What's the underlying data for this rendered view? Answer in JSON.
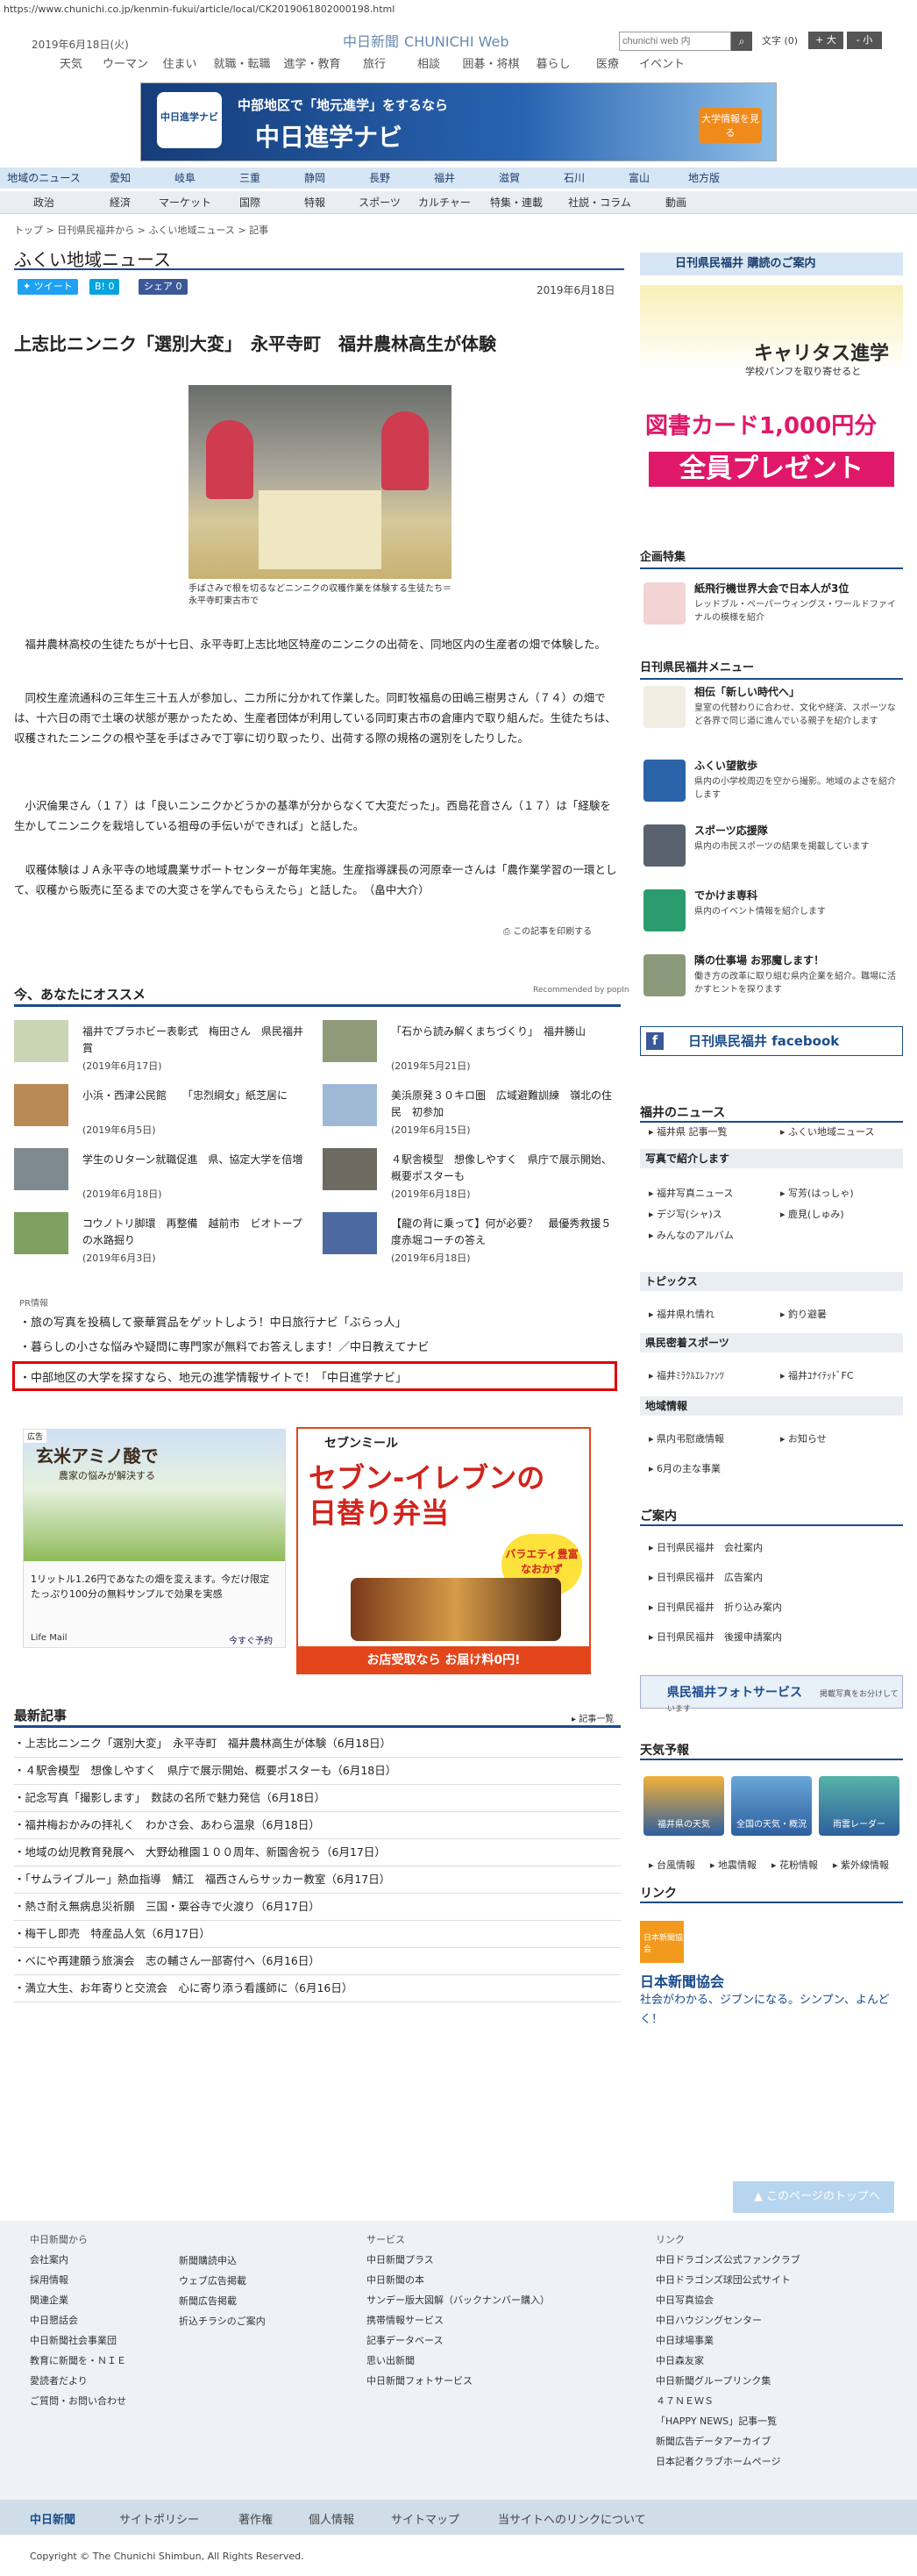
{
  "browser": {
    "url": "https://www.chunichi.co.jp/kenmin-fukui/article/local/CK2019061802000198.html"
  },
  "header": {
    "date": "2019年6月18日(火)",
    "logo": "中日新聞",
    "logo_sub": "CHUNICHI Web",
    "search_placeholder": "chunichi web 内",
    "search_btn": "検索",
    "font_label": "文字",
    "font_reset": "(0)",
    "font_large": "+ 大",
    "font_small": "- 小"
  },
  "top_nav": [
    "天気",
    "ウーマン",
    "住まい",
    "就職・転職",
    "進学・教育",
    "旅行",
    "相談",
    "囲碁・将棋",
    "暮らし",
    "医療",
    "イベント"
  ],
  "banner": {
    "badge": "中日進学ナビ",
    "line1": "中部地区で「地元進学」をするなら",
    "line2": "中日進学ナビ",
    "cta": "大学情報を見る"
  },
  "region_nav": [
    "地域のニュース",
    "愛知",
    "岐阜",
    "三重",
    "静岡",
    "長野",
    "福井",
    "滋賀",
    "石川",
    "富山",
    "地方版"
  ],
  "category_nav": [
    "政治",
    "経済",
    "マーケット",
    "国際",
    "特報",
    "スポーツ",
    "カルチャー",
    "特集・連載",
    "社説・コラム",
    "動画"
  ],
  "breadcrumb": "トップ > 日刊県民福井から > ふくい地域ニュース > 記事",
  "page_title": "ふくい地域ニュース",
  "share": {
    "tweet": "ツイート",
    "hatena": "B! 0",
    "fb": "シェア 0"
  },
  "article": {
    "date": "2019年6月18日",
    "title": "上志比ニンニク「選別大変」　永平寺町　福井農林高生が体験",
    "caption": "手ばさみで根を切るなどニンニクの収穫作業を体験する生徒たち＝永平寺町東古市で",
    "paragraphs": [
      "福井農林高校の生徒たちが十七日、永平寺町上志比地区特産のニンニクの出荷を、同地区内の生産者の畑で体験した。",
      "同校生産流通科の三年生三十五人が参加し、二カ所に分かれて作業した。同町牧福島の田嶋三樹男さん（７４）の畑では、十六日の雨で土壌の状態が悪かったため、生産者団体が利用している同町東古市の倉庫内で取り組んだ。生徒たちは、収穫されたニンニクの根や茎を手ばさみで丁寧に切り取ったり、出荷する際の規格の選別をしたりした。",
      "小沢倫果さん（１７）は「良いニンニクかどうかの基準が分からなくて大変だった」。西島花音さん（１７）は「経験を生かしてニンニクを栽培している祖母の手伝いができれば」と話した。",
      "収穫体験はＪＡ永平寺の地域農業サポートセンターが毎年実施。生産指導課長の河原幸一さんは「農作業学習の一環として、収穫から販売に至るまでの大変さを学んでもらえたら」と話した。　（畠中大介）"
    ],
    "print": "この記事を印刷する"
  },
  "recommend": {
    "title": "今、あなたにオススメ",
    "by": "Recommended by popIn",
    "items": [
      {
        "title": "福井でプラホビー表彰式　梅田さん　県民福井賞",
        "date": "(2019年6月17日)"
      },
      {
        "title": "「石から読み解くまちづくり」　福井勝山",
        "date": "(2019年5月21日)"
      },
      {
        "title": "小浜・西津公民館　　「忠烈綱女」紙芝居に",
        "date": "(2019年6月5日)"
      },
      {
        "title": "美浜原発３０キロ圏　広域避難訓練　嶺北の住民　初参加",
        "date": "(2019年6月15日)"
      },
      {
        "title": "学生のＵターン就職促進　県、協定大学を倍増",
        "date": "(2019年6月18日)"
      },
      {
        "title": "４駅舎模型　想像しやすく　県庁で展示開始、概要ポスターも",
        "date": "(2019年6月18日)"
      },
      {
        "title": "コウノトリ脚環　再整備　越前市　ビオトープの水路掘り",
        "date": "(2019年6月3日)"
      },
      {
        "title": "【龍の背に乗って】何が必要？　最優秀救援５度赤堀コーチの答え",
        "date": "(2019年6月18日)"
      }
    ]
  },
  "pr": {
    "label": "PR情報",
    "links": [
      "旅の写真を投稿して豪華賞品をゲットしよう！中日旅行ナビ「ぶらっ人」",
      "暮らしの小さな悩みや疑問に専門家が無料でお答えします！／中日教えてナビ",
      "中部地区の大学を探すなら、地元の進学情報サイトで！「中日進学ナビ」"
    ]
  },
  "ads": {
    "ad1_label": "広告",
    "ad1_big": "玄米アミノ酸で",
    "ad1_sub": "農家の悩みが解決する",
    "ad1_text": "1リットル1.26円であなたの畑を変えます。今だけ限定たっぷり100分の無料サンプルで効果を実感",
    "ad1_sponsor": "Life Mail",
    "ad1_link": "今すぐ予約",
    "ad2_head": "セブンミール",
    "ad2_big": "セブン-イレブンの日替り弁当",
    "ad2_badge": "バラエティ豊富なおかず",
    "ad2_foot": "お店受取なら お届け料0円!"
  },
  "latest": {
    "title": "最新記事",
    "all": "記事一覧",
    "items": [
      "上志比ニンニク「選別大変」　永平寺町　福井農林高生が体験（6月18日）",
      "４駅舎模型　想像しやすく　県庁で展示開始、概要ポスターも（6月18日）",
      "記念写真「撮影します」　数誌の名所で魅力発信（6月18日）",
      "福井梅おかみの拝礼く　わかさ会、あわら温泉（6月18日）",
      "地域の幼児教育発展へ　大野幼稚園１００周年、新園舎祝う（6月17日）",
      "「サムライブルー」熱血指導　鯖江　福西さんらサッカー教室（6月17日）",
      "熱さ耐え無病息災祈願　三国・粟谷寺で火渡り（6月17日）",
      "梅干し即売　特産品人気（6月17日）",
      "べにや再建願う旅演会　志の輔さん一部寄付へ（6月16日）",
      "満立大生、お年寄りと交流会　心に寄り添う看護師に（6月16日）"
    ]
  },
  "sidebar": {
    "subscribe": "日刊県民福井 購読のご案内",
    "ad_brand": "キャリタス進学",
    "ad_text": "学校パンフを取り寄せると",
    "ad_big": "図書カード1,000円分",
    "ad_foot": "全員プレゼント",
    "kikaku_title": "企画特集",
    "kikaku_item_title": "紙飛行機世界大会で日本人が3位",
    "kikaku_item_desc": "レッドブル・ペーパーウィングス・ワールドファイナルの模様を紹介",
    "menu_title": "日刊県民福井メニュー",
    "menu": [
      {
        "title": "相伝「新しい時代へ」",
        "desc": "皇室の代替わりに合わせ、文化や経済、スポーツなど各界で同じ道に進んでいる親子を紹介します"
      },
      {
        "title": "ふくい望散歩",
        "desc": "県内の小学校周辺を空から撮影。地域のよさを紹介します"
      },
      {
        "title": "スポーツ応援隊",
        "desc": "県内の市民スポーツの結果を掲載しています"
      },
      {
        "title": "でかけま専科",
        "desc": "県内のイベント情報を紹介します"
      },
      {
        "title": "隣の仕事場 お邪魔します！",
        "desc": "働き方の改革に取り組む県内企業を紹介。職場に活かすヒントを探ります"
      }
    ],
    "fb": "日刊県民福井 facebook",
    "news_title": "福井のニュース",
    "news_links": [
      "福井県 記事一覧",
      "ふくい地域ニュース"
    ],
    "photo_sec": "写真で紹介します",
    "photo_links": [
      "福井写真ニュース",
      "写芳(はっしゃ)",
      "デジ写(シャ)ス",
      "鹿見(しゅみ)",
      "みんなのアルバム"
    ],
    "topics_sec": "トピックス",
    "topics_links": [
      "福井県れ情れ",
      "釣り避暑"
    ],
    "sports_sec": "県民密着スポーツ",
    "sports_links": [
      "福井ﾐﾗｸﾙｴﾚﾌｧﾝﾂ",
      "福井ﾕﾅｲﾃｯﾄﾞFC"
    ],
    "region_sec": "地域情報",
    "region_links": [
      "県内弔慰歳情報",
      "お知らせ",
      "6月の主な事業"
    ],
    "annai_title": "ご案内",
    "annai_links": [
      "日刊県民福井　会社案内",
      "日刊県民福井　広告案内",
      "日刊県民福井　折り込み案内",
      "日刊県民福井　後援申請案内"
    ],
    "photo_service": "県民福井フォトサービス",
    "photo_service_sub": "掲載写真をお分けしています",
    "weather_title": "天気予報",
    "weather": [
      "福井県の天気",
      "全国の天気・概況",
      "雨雲レーダー"
    ],
    "weather_links": [
      "台風情報",
      "地震情報",
      "花粉情報",
      "紫外線情報"
    ],
    "link_title": "リンク",
    "link_logo": "日本新聞協会",
    "link_org": "日本新聞協会",
    "link_desc": "社会がわかる、ジブンになる。シンプン、よんどく！"
  },
  "page_top": "このページのトップへ",
  "footer": {
    "col1_head": "中日新聞から",
    "col1": [
      "会社案内",
      "採用情報",
      "関連企業",
      "中日懇話会",
      "中日新聞社会事業団",
      "教育に新聞を・ＮＩＥ",
      "愛読者だより",
      "ご質問・お問い合わせ"
    ],
    "col2": [
      "新聞購読申込",
      "ウェブ広告掲載",
      "新聞広告掲載",
      "折込チラシのご案内"
    ],
    "col3_head": "サービス",
    "col3": [
      "中日新聞プラス",
      "中日新聞の本",
      "サンデー版大図解（バックナンバー購入）",
      "携帯情報サービス",
      "記事データベース",
      "思い出新聞",
      "中日新聞フォトサービス"
    ],
    "col4_head": "リンク",
    "col4": [
      "中日ドラゴンズ公式ファンクラブ",
      "中日ドラゴンズ球団公式サイト",
      "中日写真協会",
      "中日ハウジングセンター",
      "中日球場事業",
      "中日森友家",
      "中日新聞グループリンク集",
      "４７ＮＥＷＳ",
      "「HAPPY NEWS」記事一覧",
      "新聞広告データアーカイブ",
      "日本記者クラブホームページ"
    ],
    "bar": [
      "中日新聞",
      "サイトポリシー",
      "著作権",
      "個人情報",
      "サイトマップ",
      "当サイトへのリンクについて"
    ],
    "copyright": "Copyright © The Chunichi Shimbun, All Rights Reserved."
  },
  "colors": {
    "accent": "#1a4c8b",
    "pr_border": "#dd0000",
    "twitter": "#1da1f2",
    "hatena": "#00a4de",
    "facebook": "#3b5998"
  }
}
